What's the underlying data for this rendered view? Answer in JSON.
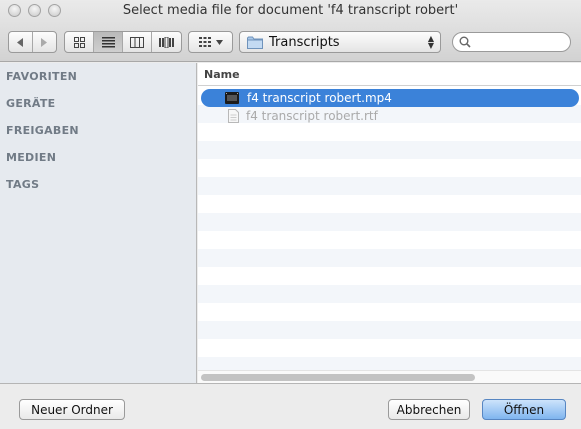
{
  "window": {
    "title": "Select media file for document 'f4 transcript robert'"
  },
  "toolbar": {
    "back_icon": "chevron-left-icon",
    "forward_icon": "chevron-right-icon",
    "view_modes": [
      "icon-view-icon",
      "list-view-icon",
      "column-view-icon",
      "coverflow-view-icon"
    ],
    "active_view": "list-view-icon",
    "arrange_icon": "arrange-grid-icon",
    "location": "Transcripts",
    "search": {
      "value": "",
      "placeholder": ""
    }
  },
  "sidebar": {
    "sections": [
      "FAVORITEN",
      "GERÄTE",
      "FREIGABEN",
      "MEDIEN",
      "TAGS"
    ]
  },
  "list": {
    "column_header": "Name",
    "files": [
      {
        "name": "f4 transcript robert.mp4",
        "icon": "video-file-icon",
        "selected": true,
        "enabled": true
      },
      {
        "name": "f4 transcript robert.rtf",
        "icon": "document-file-icon",
        "selected": false,
        "enabled": false
      }
    ]
  },
  "buttons": {
    "new_folder": "Neuer Ordner",
    "cancel": "Abbrechen",
    "open": "Öffnen"
  },
  "colors": {
    "selection": "#3b82d9",
    "sidebar_bg": "#e6eaef",
    "stripe": "#f3f6fa"
  }
}
